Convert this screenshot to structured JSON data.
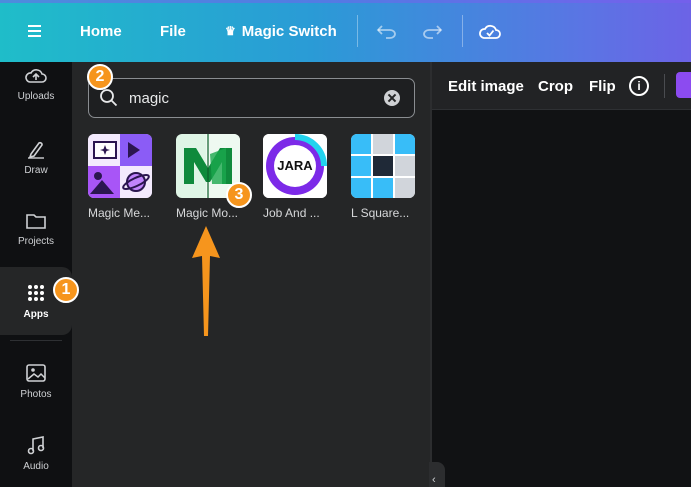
{
  "topbar": {
    "menu_icon": "hamburger-icon",
    "home": "Home",
    "file": "File",
    "magic_switch": "Magic Switch",
    "crown_icon": "crown-icon",
    "undo_icon": "undo-icon",
    "redo_icon": "redo-icon",
    "cloud_icon": "cloud-check-icon",
    "gradient": [
      "#1fbdc9",
      "#2a9bd6",
      "#5b74e4",
      "#6c63e6"
    ]
  },
  "rail": {
    "items": [
      {
        "label": "Uploads",
        "icon": "upload-icon"
      },
      {
        "label": "Draw",
        "icon": "pen-icon"
      },
      {
        "label": "Projects",
        "icon": "folder-icon"
      },
      {
        "label": "Apps",
        "icon": "apps-grid-icon",
        "active": true
      },
      {
        "label": "Photos",
        "icon": "image-icon"
      },
      {
        "label": "Audio",
        "icon": "music-note-icon"
      }
    ]
  },
  "panel": {
    "search": {
      "value": "magic",
      "search_icon": "search-icon",
      "clear_icon": "clear-icon"
    },
    "results": [
      {
        "name": "Magic Me...",
        "icon": "magic-media-icon"
      },
      {
        "name": "Magic Mo...",
        "icon": "magic-morph-icon"
      },
      {
        "name": "Job And ...",
        "icon": "jara-icon",
        "logo_text": "JARA"
      },
      {
        "name": "L Square...",
        "icon": "l-squared-icon"
      }
    ]
  },
  "toolbar": {
    "edit_image": "Edit image",
    "crop": "Crop",
    "flip": "Flip",
    "info": "i"
  },
  "annotations": {
    "badge_1": "1",
    "badge_2": "2",
    "badge_3": "3",
    "color": "#f6951d"
  }
}
